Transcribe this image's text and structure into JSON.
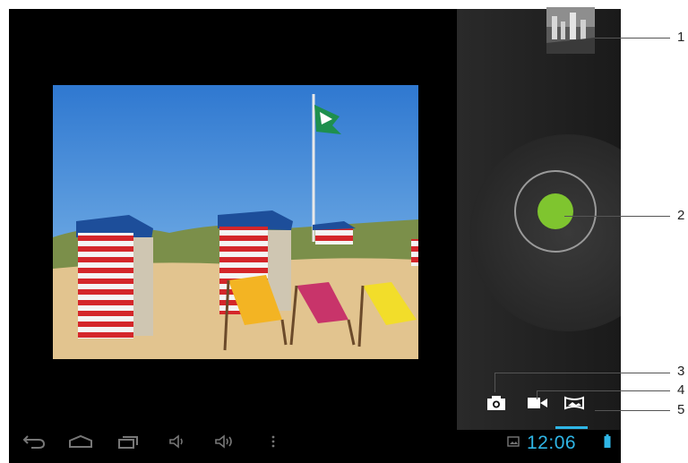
{
  "callouts": [
    "1",
    "2",
    "3",
    "4",
    "5"
  ],
  "status_bar": {
    "time": "12:06"
  },
  "camera": {
    "modes": [
      "photo-mode",
      "video-mode",
      "panorama-mode"
    ],
    "active_mode": "panorama-mode",
    "shutter_color": "#7fc52f",
    "accent_color": "#2fb6e6"
  },
  "nav": [
    "back",
    "home",
    "recent-apps",
    "volume-down",
    "volume-up",
    "menu"
  ]
}
